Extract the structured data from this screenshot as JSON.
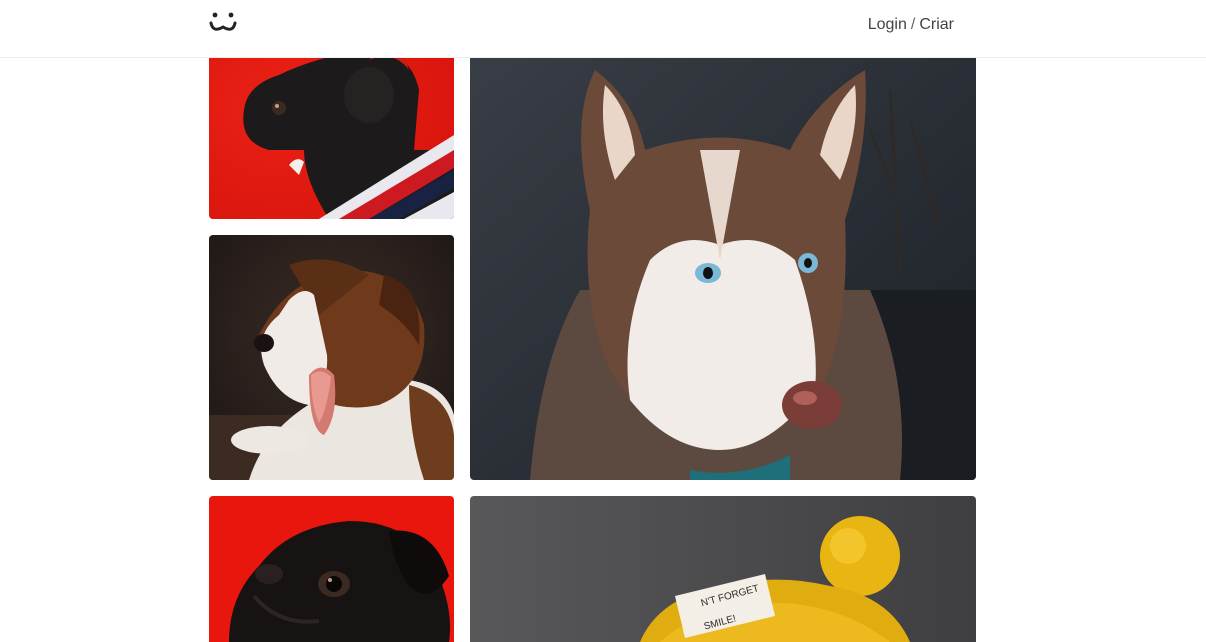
{
  "header": {
    "logo_icon": "paw-face-icon",
    "login_label": "Login",
    "separator": "/",
    "signup_label": "Criar"
  },
  "feed": {
    "photos": [
      {
        "subject": "pug",
        "background": "#e8160c"
      },
      {
        "subject": "husky",
        "background": "#2b2f36"
      },
      {
        "subject": "puppy",
        "background": "#2a2220"
      },
      {
        "subject": "pug",
        "background": "#e8160c"
      },
      {
        "subject": "yellow-beanie",
        "background": "#4a4a4c"
      }
    ]
  },
  "colors": {
    "text": "#444444",
    "divider": "#eeeeee"
  }
}
